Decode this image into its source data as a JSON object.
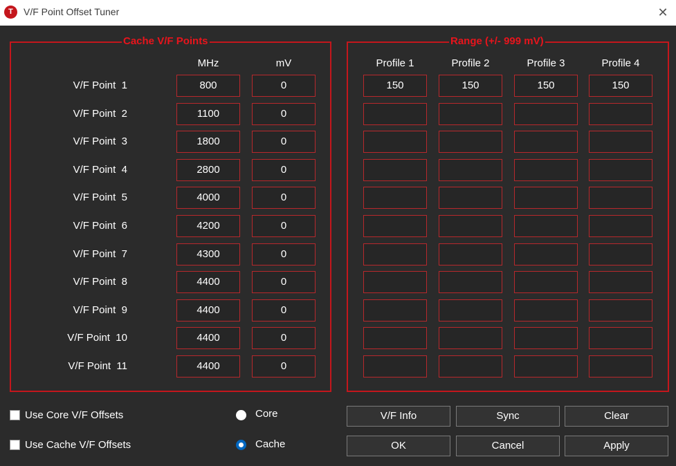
{
  "window": {
    "title": "V/F Point Offset Tuner",
    "app_icon_letter": "T",
    "close_glyph": "✕"
  },
  "cache_group": {
    "title": "Cache V/F Points",
    "col_mhz": "MHz",
    "col_mv": "mV",
    "rows": [
      {
        "label": "V/F Point  1",
        "mhz": "800",
        "mv": "0"
      },
      {
        "label": "V/F Point  2",
        "mhz": "1100",
        "mv": "0"
      },
      {
        "label": "V/F Point  3",
        "mhz": "1800",
        "mv": "0"
      },
      {
        "label": "V/F Point  4",
        "mhz": "2800",
        "mv": "0"
      },
      {
        "label": "V/F Point  5",
        "mhz": "4000",
        "mv": "0"
      },
      {
        "label": "V/F Point  6",
        "mhz": "4200",
        "mv": "0"
      },
      {
        "label": "V/F Point  7",
        "mhz": "4300",
        "mv": "0"
      },
      {
        "label": "V/F Point  8",
        "mhz": "4400",
        "mv": "0"
      },
      {
        "label": "V/F Point  9",
        "mhz": "4400",
        "mv": "0"
      },
      {
        "label": "V/F Point  10",
        "mhz": "4400",
        "mv": "0"
      },
      {
        "label": "V/F Point  11",
        "mhz": "4400",
        "mv": "0"
      }
    ]
  },
  "range_group": {
    "title": "Range (+/- 999 mV)",
    "profiles": [
      "Profile 1",
      "Profile 2",
      "Profile 3",
      "Profile 4"
    ],
    "values": [
      [
        "150",
        "150",
        "150",
        "150"
      ],
      [
        "",
        "",
        "",
        ""
      ],
      [
        "",
        "",
        "",
        ""
      ],
      [
        "",
        "",
        "",
        ""
      ],
      [
        "",
        "",
        "",
        ""
      ],
      [
        "",
        "",
        "",
        ""
      ],
      [
        "",
        "",
        "",
        ""
      ],
      [
        "",
        "",
        "",
        ""
      ],
      [
        "",
        "",
        "",
        ""
      ],
      [
        "",
        "",
        "",
        ""
      ],
      [
        "",
        "",
        "",
        ""
      ]
    ]
  },
  "options": {
    "use_core_label": "Use Core V/F Offsets",
    "use_core_checked": false,
    "use_cache_label": "Use Cache V/F Offsets",
    "use_cache_checked": false,
    "radio_core_label": "Core",
    "radio_cache_label": "Cache",
    "selected_radio": "Cache"
  },
  "buttons": {
    "vf_info": "V/F Info",
    "sync": "Sync",
    "clear": "Clear",
    "ok": "OK",
    "cancel": "Cancel",
    "apply": "Apply"
  },
  "colors": {
    "background": "#2b2b2b",
    "accent_red": "#e8141c",
    "cell_border": "#b8282c",
    "radio_selected": "#0067c0"
  }
}
